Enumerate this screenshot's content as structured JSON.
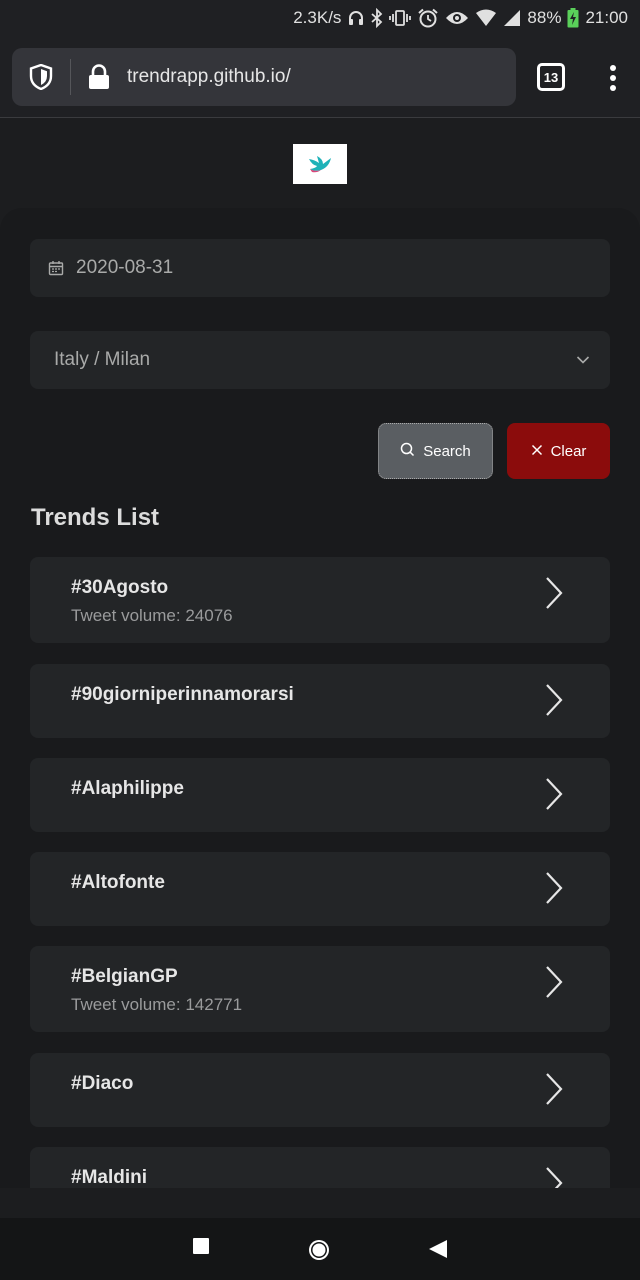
{
  "status_bar": {
    "net_speed": "2.3K/s",
    "battery_pct": "88%",
    "time": "21:00",
    "icons": [
      "headset-icon",
      "bluetooth-icon",
      "vibrate-icon",
      "alarm-icon",
      "eye-icon",
      "wifi-icon",
      "signal-icon",
      "battery-charging-icon"
    ]
  },
  "browser": {
    "url": "trendrapp.github.io/",
    "tab_count": "13",
    "icons": [
      "shield-icon",
      "lock-icon",
      "menu-kebab-icon"
    ]
  },
  "form": {
    "date_value": "2020-08-31",
    "region_value": "Italy / Milan",
    "search_label": "Search",
    "clear_label": "Clear"
  },
  "trends": {
    "title": "Trends List",
    "items": [
      {
        "tag": "#30Agosto",
        "volume": "Tweet volume: 24076"
      },
      {
        "tag": "#90giorniperinnamorarsi",
        "volume": ""
      },
      {
        "tag": "#Alaphilippe",
        "volume": ""
      },
      {
        "tag": "#Altofonte",
        "volume": ""
      },
      {
        "tag": "#BelgianGP",
        "volume": "Tweet volume: 142771"
      },
      {
        "tag": "#Diaco",
        "volume": ""
      },
      {
        "tag": "#Maldini",
        "volume": ""
      }
    ]
  },
  "colors": {
    "background": "#1c1d1f",
    "card": "#232527",
    "search_button": "#5a5e62",
    "clear_button": "#8b0c0c"
  }
}
